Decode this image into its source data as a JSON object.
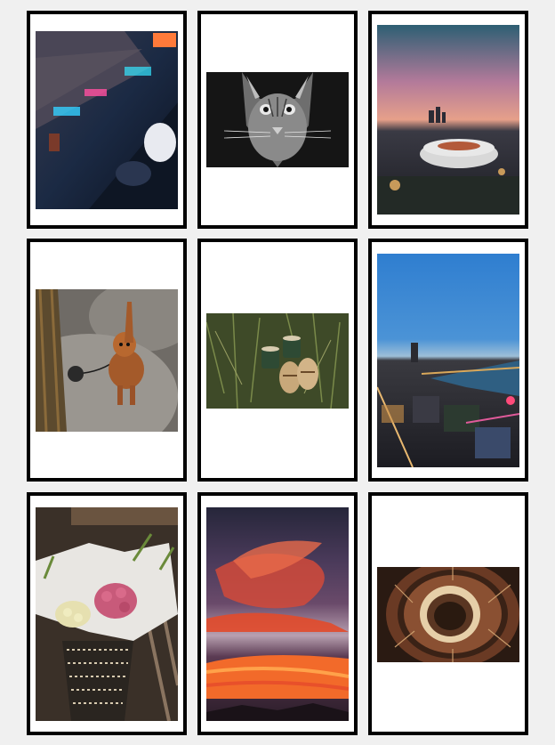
{
  "gallery": {
    "photos": [
      {
        "subject": "neon-street-photo"
      },
      {
        "subject": "cat-photo"
      },
      {
        "subject": "stadium-sunset-photo"
      },
      {
        "subject": "dog-on-rock-photo"
      },
      {
        "subject": "coffee-cups-grass-photo"
      },
      {
        "subject": "city-river-night-photo"
      },
      {
        "subject": "flower-basket-photo"
      },
      {
        "subject": "red-sky-sunset-photo"
      },
      {
        "subject": "spiral-staircase-photo"
      }
    ]
  },
  "colors": {
    "page_background": "#f0f0f0",
    "card_background": "#ffffff",
    "card_border": "#000000"
  }
}
